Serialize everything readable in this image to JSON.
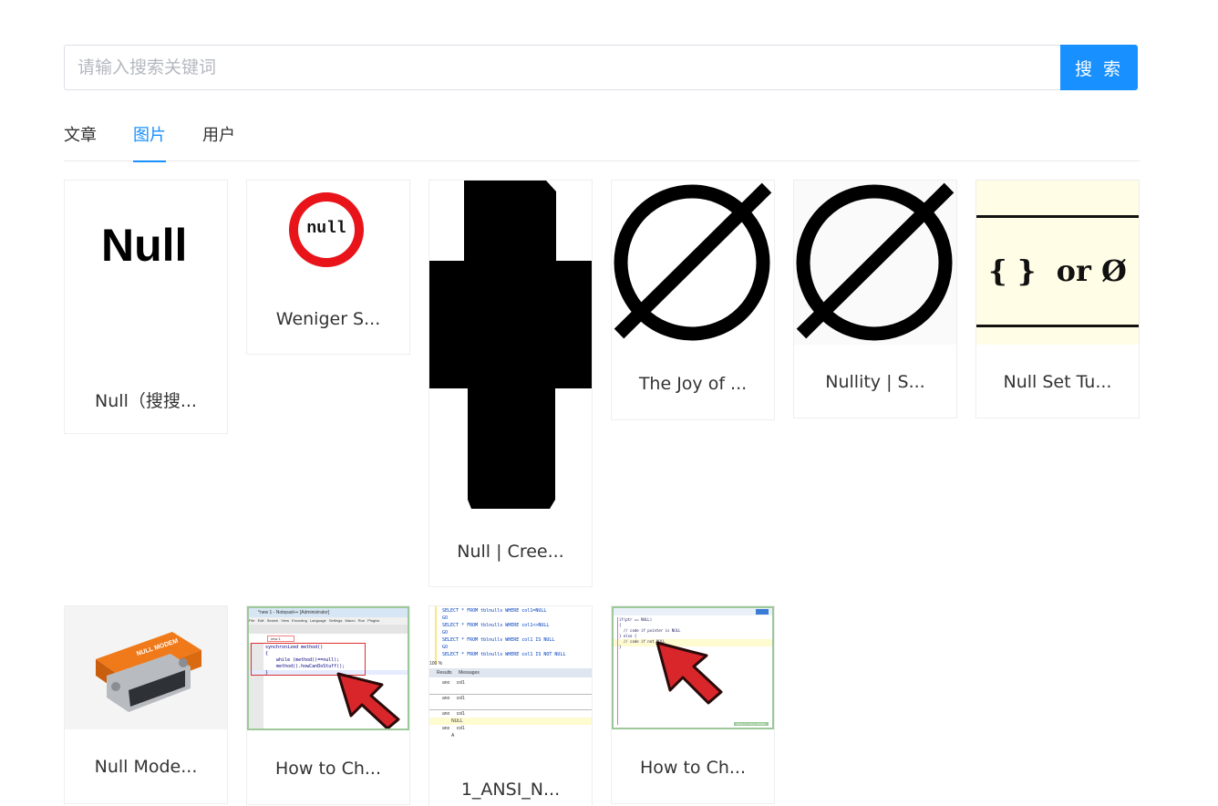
{
  "search": {
    "placeholder": "请输入搜索关键词",
    "button_label": "搜 索"
  },
  "tabs": [
    {
      "label": "文章",
      "active": false
    },
    {
      "label": "图片",
      "active": true
    },
    {
      "label": "用户",
      "active": false
    }
  ],
  "results": [
    {
      "title": "Null（搜搜...",
      "image": "Null",
      "image_type": "text"
    },
    {
      "title": "Weniger S...",
      "image": "null",
      "image_type": "ring-sign"
    },
    {
      "title": "Null | Cree...",
      "image_type": "creeper-silhouette"
    },
    {
      "title": "The Joy of ...",
      "image_type": "empty-set-symbol"
    },
    {
      "title": "Nullity | S...",
      "image_type": "empty-set-symbol"
    },
    {
      "title": "Null Set Tu...",
      "image": "{ }  or Ø",
      "image_type": "text"
    },
    {
      "title": "Null Mode...",
      "image": "NULL MODEM",
      "image_type": "adapter-photo"
    },
    {
      "title": "How to Ch...",
      "image_type": "notepad-screenshot"
    },
    {
      "title": "1_ANSI_N...",
      "image_type": "sql-screenshot"
    },
    {
      "title": "How to Ch...",
      "image_type": "editor-screenshot"
    }
  ],
  "thumb_text": {
    "notepad_title": "*new 1 - Notepad++ [Administrator]",
    "notepad_menu": [
      "File",
      "Edit",
      "Search",
      "View",
      "Encoding",
      "Language",
      "Settings",
      "Macro",
      "Run",
      "Plugins"
    ],
    "notepad_tab": "new 1",
    "notepad_code": [
      "synchronized method()",
      "{",
      "    while (method()==null);",
      "    method().howCanDoStuff();",
      "}"
    ],
    "sql_lines": [
      "SELECT * FROM tblnulls WHERE col1=NULL",
      "GO",
      "SELECT * FROM tblnulls WHERE col1<>NULL",
      "GO",
      "SELECT * FROM tblnulls WHERE col1 IS NULL",
      "GO",
      "SELECT * FROM tblnulls WHERE col1 IS NOT NULL"
    ],
    "sql_zoom": "100 %",
    "sql_tabs": [
      "Results",
      "Messages"
    ],
    "sql_grid": [
      "ano",
      "col1",
      "NULL",
      "A"
    ],
    "editor_lines": [
      "if(ptr == NULL)",
      "{",
      "  // code if pointer is NULL",
      "} else {",
      "  // code if not NULL",
      "}"
    ],
    "editor_status": "Marvel in Career Builder"
  },
  "colors": {
    "accent": "#1890ff",
    "sign_red": "#e8141a",
    "arrow_red": "#d9262b",
    "cream": "#fffde6",
    "adapter_orange": "#f07a1a"
  }
}
